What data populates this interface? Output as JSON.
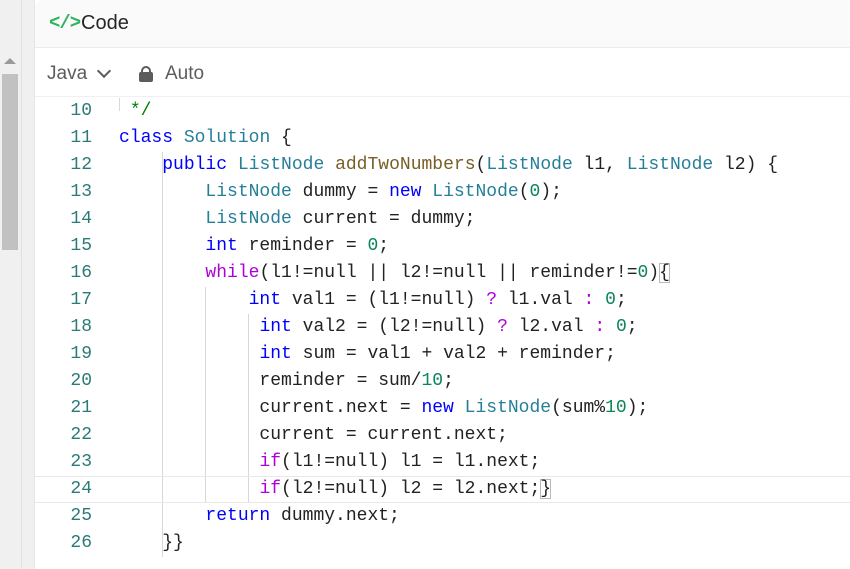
{
  "panel": {
    "title": "Code",
    "icon": "code-icon",
    "accent_color": "#2db55d"
  },
  "toolbar": {
    "language": "Java",
    "mode": "Auto"
  },
  "editor": {
    "current_line": 24,
    "lines": [
      {
        "n": "10",
        "text": " */"
      },
      {
        "n": "11",
        "text": "class Solution {"
      },
      {
        "n": "12",
        "text": "    public ListNode addTwoNumbers(ListNode l1, ListNode l2) {"
      },
      {
        "n": "13",
        "text": "        ListNode dummy = new ListNode(0);"
      },
      {
        "n": "14",
        "text": "        ListNode current = dummy;"
      },
      {
        "n": "15",
        "text": "        int reminder = 0;"
      },
      {
        "n": "16",
        "text": "        while(l1!=null || l2!=null || reminder!=0){"
      },
      {
        "n": "17",
        "text": "            int val1 = (l1!=null) ? l1.val : 0;"
      },
      {
        "n": "18",
        "text": "             int val2 = (l2!=null) ? l2.val : 0;"
      },
      {
        "n": "19",
        "text": "             int sum = val1 + val2 + reminder;"
      },
      {
        "n": "20",
        "text": "             reminder = sum/10;"
      },
      {
        "n": "21",
        "text": "             current.next = new ListNode(sum%10);"
      },
      {
        "n": "22",
        "text": "             current = current.next;"
      },
      {
        "n": "23",
        "text": "             if(l1!=null) l1 = l1.next;"
      },
      {
        "n": "24",
        "text": "             if(l2!=null) l2 = l2.next;}"
      },
      {
        "n": "25",
        "text": "        return dummy.next;"
      },
      {
        "n": "26",
        "text": "    }}"
      }
    ]
  }
}
